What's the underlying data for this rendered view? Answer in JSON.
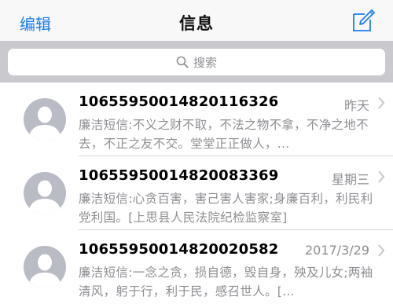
{
  "navbar": {
    "edit_label": "编辑",
    "title": "信息",
    "compose_icon": "compose-icon"
  },
  "search": {
    "placeholder": "搜索",
    "icon": "search-icon"
  },
  "messages": [
    {
      "sender": "10655950014820116326",
      "date": "昨天",
      "preview": "廉洁短信:不义之财不取，不法之物不拿，不净之地不去，不正之友不交。堂堂正正做人，…"
    },
    {
      "sender": "10655950014820083369",
      "date": "星期三",
      "preview": "廉洁短信:心贪百害，害己害人害家;身廉百利，利民利党利国。[上思县人民法院纪检监察室]"
    },
    {
      "sender": "10655950014820020582",
      "date": "2017/3/29",
      "preview": "廉洁短信:一念之贪，损自德，毁自身，殃及儿女;两袖清风，躬于行，利于民，感召世人。[…"
    }
  ],
  "colors": {
    "accent": "#1b7cf0",
    "secondary_text": "#8e8e93",
    "search_bg": "#c9c9ce",
    "avatar": "#b9bcc4"
  }
}
